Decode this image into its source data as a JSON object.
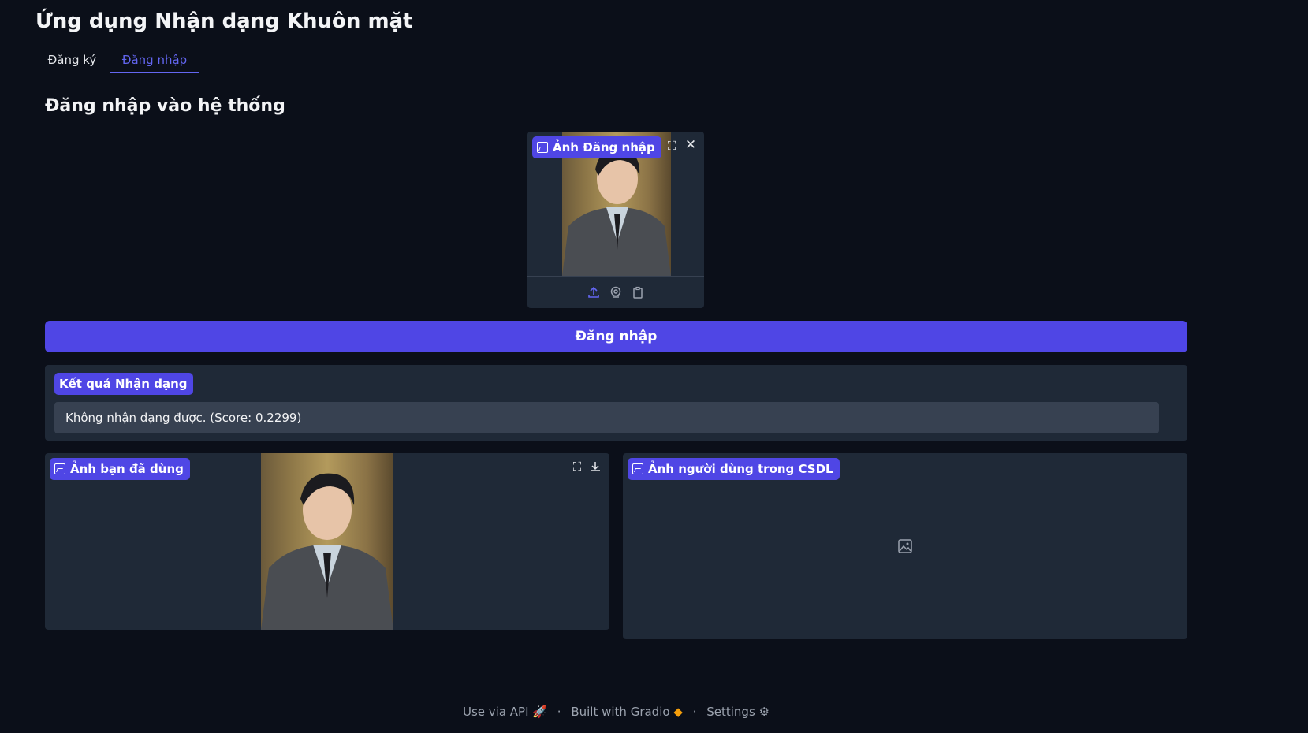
{
  "app": {
    "title": "Ứng dụng Nhận dạng Khuôn mặt"
  },
  "tabs": [
    {
      "label": "Đăng ký",
      "active": false
    },
    {
      "label": "Đăng nhập",
      "active": true
    }
  ],
  "login": {
    "heading": "Đăng nhập vào hệ thống",
    "image_label": "Ảnh Đăng nhập",
    "button_label": "Đăng nhập"
  },
  "result": {
    "label": "Kết quả Nhận dạng",
    "text": "Không nhận dạng được. (Score: 0.2299)"
  },
  "used_image": {
    "label": "Ảnh bạn đã dùng"
  },
  "db_image": {
    "label": "Ảnh người dùng trong CSDL"
  },
  "footer": {
    "api": "Use via API",
    "built": "Built with Gradio",
    "settings": "Settings"
  },
  "colors": {
    "background": "#0b0f19",
    "panel": "#1f2937",
    "accent": "#4f46e5",
    "active_tab": "#6366f1"
  },
  "icons": [
    "fullscreen-icon",
    "close-icon",
    "upload-icon",
    "webcam-icon",
    "clipboard-icon",
    "download-icon",
    "image-placeholder-icon",
    "rocket-icon",
    "gradio-logo-icon",
    "gear-icon"
  ]
}
